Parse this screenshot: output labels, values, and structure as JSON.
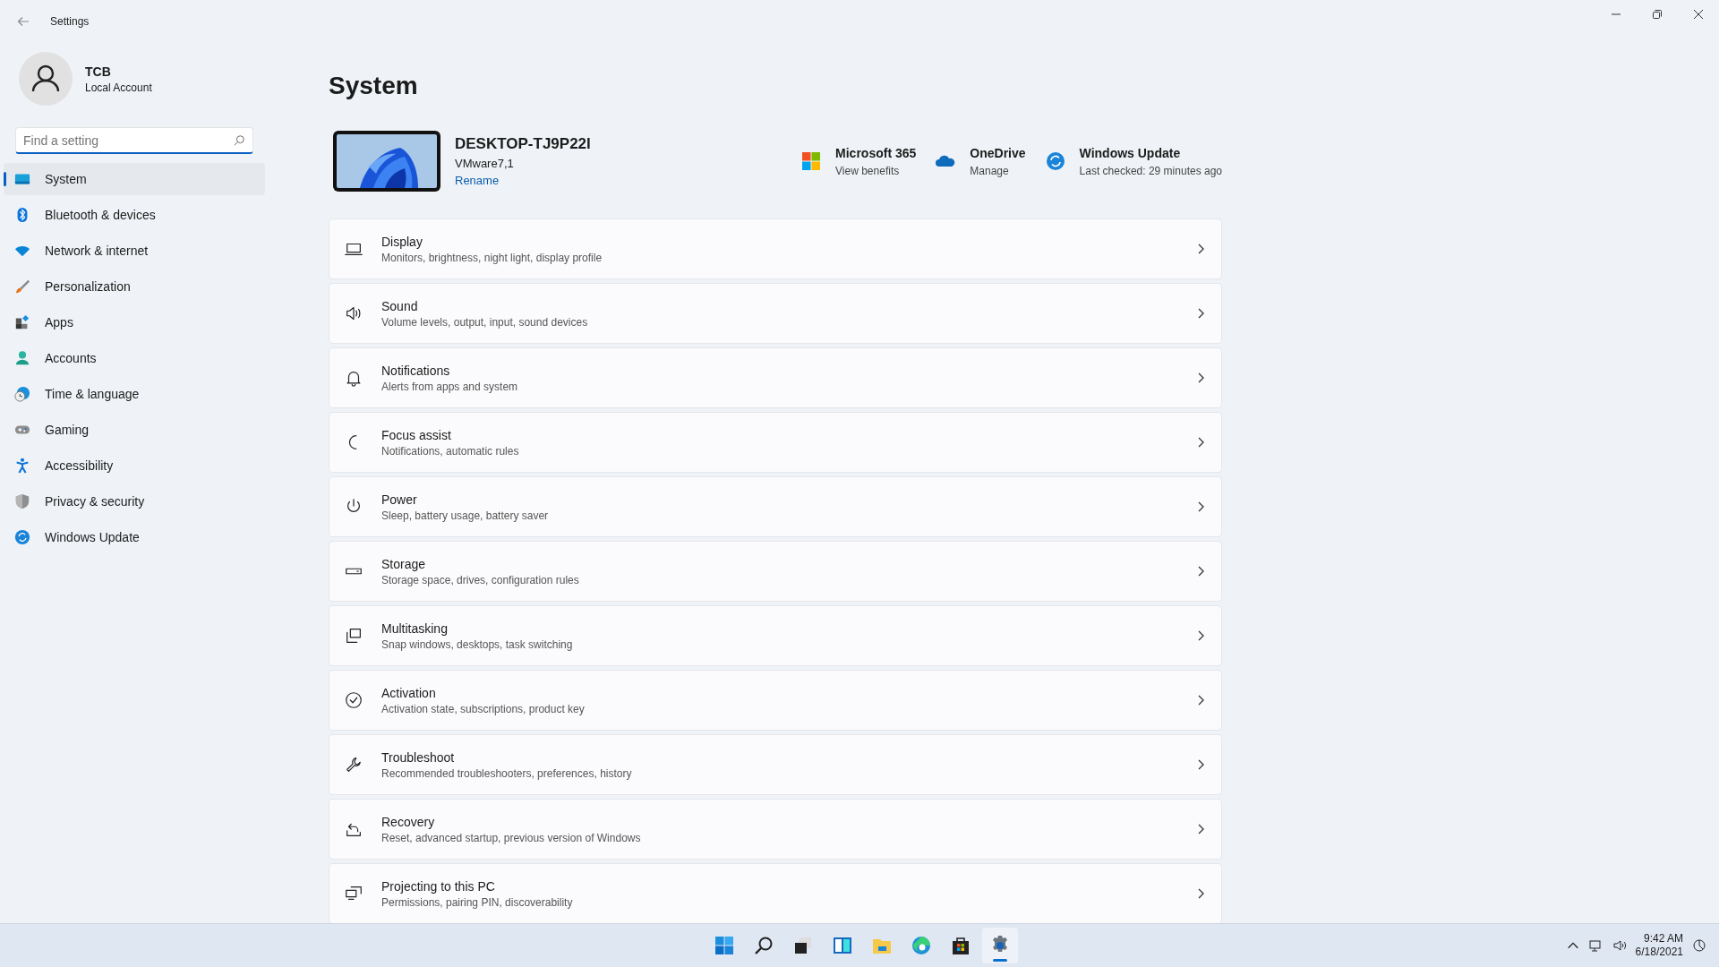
{
  "window": {
    "title": "Settings"
  },
  "account": {
    "name": "TCB",
    "type": "Local Account"
  },
  "search": {
    "placeholder": "Find a setting"
  },
  "sidebar": {
    "items": [
      {
        "label": "System",
        "selected": true
      },
      {
        "label": "Bluetooth & devices",
        "selected": false
      },
      {
        "label": "Network & internet",
        "selected": false
      },
      {
        "label": "Personalization",
        "selected": false
      },
      {
        "label": "Apps",
        "selected": false
      },
      {
        "label": "Accounts",
        "selected": false
      },
      {
        "label": "Time & language",
        "selected": false
      },
      {
        "label": "Gaming",
        "selected": false
      },
      {
        "label": "Accessibility",
        "selected": false
      },
      {
        "label": "Privacy & security",
        "selected": false
      },
      {
        "label": "Windows Update",
        "selected": false
      }
    ]
  },
  "page_title": "System",
  "device": {
    "name": "DESKTOP-TJ9P22I",
    "model": "VMware7,1",
    "rename_link": "Rename"
  },
  "quick_links": [
    {
      "title": "Microsoft 365",
      "subtitle": "View benefits"
    },
    {
      "title": "OneDrive",
      "subtitle": "Manage"
    },
    {
      "title": "Windows Update",
      "subtitle": "Last checked: 29 minutes ago"
    }
  ],
  "settings": [
    {
      "title": "Display",
      "description": "Monitors, brightness, night light, display profile"
    },
    {
      "title": "Sound",
      "description": "Volume levels, output, input, sound devices"
    },
    {
      "title": "Notifications",
      "description": "Alerts from apps and system"
    },
    {
      "title": "Focus assist",
      "description": "Notifications, automatic rules"
    },
    {
      "title": "Power",
      "description": "Sleep, battery usage, battery saver"
    },
    {
      "title": "Storage",
      "description": "Storage space, drives, configuration rules"
    },
    {
      "title": "Multitasking",
      "description": "Snap windows, desktops, task switching"
    },
    {
      "title": "Activation",
      "description": "Activation state, subscriptions, product key"
    },
    {
      "title": "Troubleshoot",
      "description": "Recommended troubleshooters, preferences, history"
    },
    {
      "title": "Recovery",
      "description": "Reset, advanced startup, previous version of Windows"
    },
    {
      "title": "Projecting to this PC",
      "description": "Permissions, pairing PIN, discoverability"
    }
  ],
  "taskbar": {
    "apps": [
      {
        "selected": false
      },
      {
        "selected": false
      },
      {
        "selected": false
      },
      {
        "selected": false
      },
      {
        "selected": false
      },
      {
        "selected": false
      },
      {
        "selected": false
      },
      {
        "selected": true
      }
    ],
    "time": "9:42 AM",
    "date": "6/18/2021"
  }
}
